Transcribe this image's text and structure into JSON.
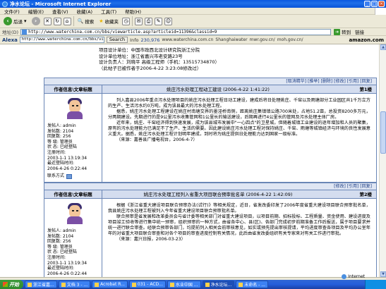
{
  "window": {
    "title": "净水论坛 - Microsoft Internet Explorer",
    "controls": [
      "_",
      "□",
      "×"
    ]
  },
  "menu": {
    "items": [
      "文件(F)",
      "编辑(E)",
      "查看(V)",
      "收藏(A)",
      "工具(T)",
      "帮助(H)"
    ]
  },
  "toolbar": {
    "back_label": "后退",
    "search_label": "搜索",
    "favorites_label": "收藏夹"
  },
  "address": {
    "label": "地址(D)",
    "url": "http://www.waterchina.com.cn/bbs/viewarticle.asp?articleid=11396&classid=9",
    "go_label": "转到",
    "links_label": "链接"
  },
  "alexa": {
    "logo": "Alexa",
    "input_value": "http://www.waterchina.com.cn/bbs/viewarticle.asp",
    "search_label": "Search",
    "info_label": "Info",
    "rank": "230,976",
    "links": [
      "www.waterchina.com.cn",
      "Shanghaiwater",
      "mwr.gov.cn/",
      "moh.gov.cn/"
    ],
    "amazon": "amazon.com"
  },
  "info_block": {
    "lines": [
      "项目设计单位：中国市政西北设计研究院浙江分院",
      "设计单位地址：浙江省嘉兴市老安路23号",
      "设计负责人：刘晓平  高级工程师（手机：13515734870）",
      "（此帖子已被作者于2006-4-22 3:23:08修改过）"
    ]
  },
  "posts": [
    {
      "actions": "[取消精华] [推举] [删除] [修改] [引用] [回复]",
      "header_left": "作者信息\\文章标题",
      "title": "姚庄污水处理工程动工建设 (2006-4-22 1:41:22)",
      "floor": "第1楼",
      "user": {
        "name": "发帖人: admin",
        "posts": "发帖数: 2104",
        "replies": "回复数: 256",
        "level": "等 级: 管理员",
        "status": "状 态: 已经登陆",
        "reg_label": "注册时间:",
        "reg_time": "2003-1-1 13:19:34",
        "last_label": "最近登陆时间:",
        "last_time": "2006-4-26 0:22:44",
        "contact": "联系方式"
      },
      "body": [
        "列入嘉县2006年重点污水处理项目的姚庄污水处理工程日动工建设，建成后将日处理姚庄、千窑以及雨塘部分工业园区共1千万立方的生产、生活污水约0万吨，成为该县最大的污水处理工程。",
        "据悉，姚庄污水处理工程建设在姚庄村南塘交界的墨泾桥南侧，距离姚庄集镇镇公路700米处，占地51.2亩，总投资8200多万元，分两期建设。先期进行的是9公里污水收集管网和1公里长的输送建设，后期再进行4公里长的管网及污水处理主体厂房。",
        "近年来，姚庄、千窑经济得到快速发展，成为该县城市发展中\"一心四点\"的卫星城，但随着城镇工业建设的逐年增加和人员的聚集，原有的污水处理能力已满足不了生产、生活的需要。因此建设姚庄污水处理工程对保持姚庄、千窑、雨塘等城镇经济与环境的良性发展意义重大。据悉，姚庄污水处理工程计划明年建成，到时将为姚庄提供日处理能力达到国家一级标准。",
        "（来源：嘉善县广播电视台，2006-4-7）"
      ]
    },
    {
      "actions": "[修改] [引用] [回复]",
      "header_left": "作者信息\\文章标题",
      "title": "姚庄污水处理工程列入省重大项目联合预审批名单 (2006-4-22 1:42:09)",
      "floor": "第2楼",
      "user": {
        "name": "发帖人: admin",
        "posts": "发帖数: 2104",
        "replies": "回复数: 256",
        "level": "等 级: 管理员",
        "status": "状 态: 已经登陆",
        "reg_label": "注册时间:",
        "reg_time": "2003-1-1 13:19:34",
        "last_label": "最近登陆时间:",
        "last_time": "2006-4-26 0:22:44"
      },
      "body": [
        "根据《浙江省重大建设项目联合预审办法(试行)》等相关规定，近日，省发改委印发了2006年度省重大建设项目联合预审批名单，我县姚庄污水处理工程被列入今年省重大建设项目联合预审批名单。",
        "联合预审是省发展和改革委员会与省计委等相关部门对省重大建设项目，以项目前期、招标投标、工程质量、资金使用、建设进度及项目竣工验收等进行集中统一预审，组织预审的一种方式，由省各中心、县(区)、各部门完成初步前期准备工作后报送，属于项目要求并统一进行联合审查。经联合预审各部门，均提前列入相关会前审核意见，如实或预先提出审核提请，平均进度审查各项目及平均办公室年年的对省重大项目联合审查和对各个项目的审查进度控制有关情况，此后由省发改委组织有关专家来对有关工作进行审批。",
        "（来源：嘉兴日报，2006-03-23）"
      ]
    }
  ],
  "status": {
    "zone": "Internet"
  },
  "taskbar": {
    "start": "开始",
    "tasks": [
      "浙江省嘉...",
      "文档 3 - ...",
      "Acrobat R...",
      "031 - ACD...",
      "水业中国 ...",
      "净水论坛...",
      "未命名 - ..."
    ],
    "clock": ""
  }
}
